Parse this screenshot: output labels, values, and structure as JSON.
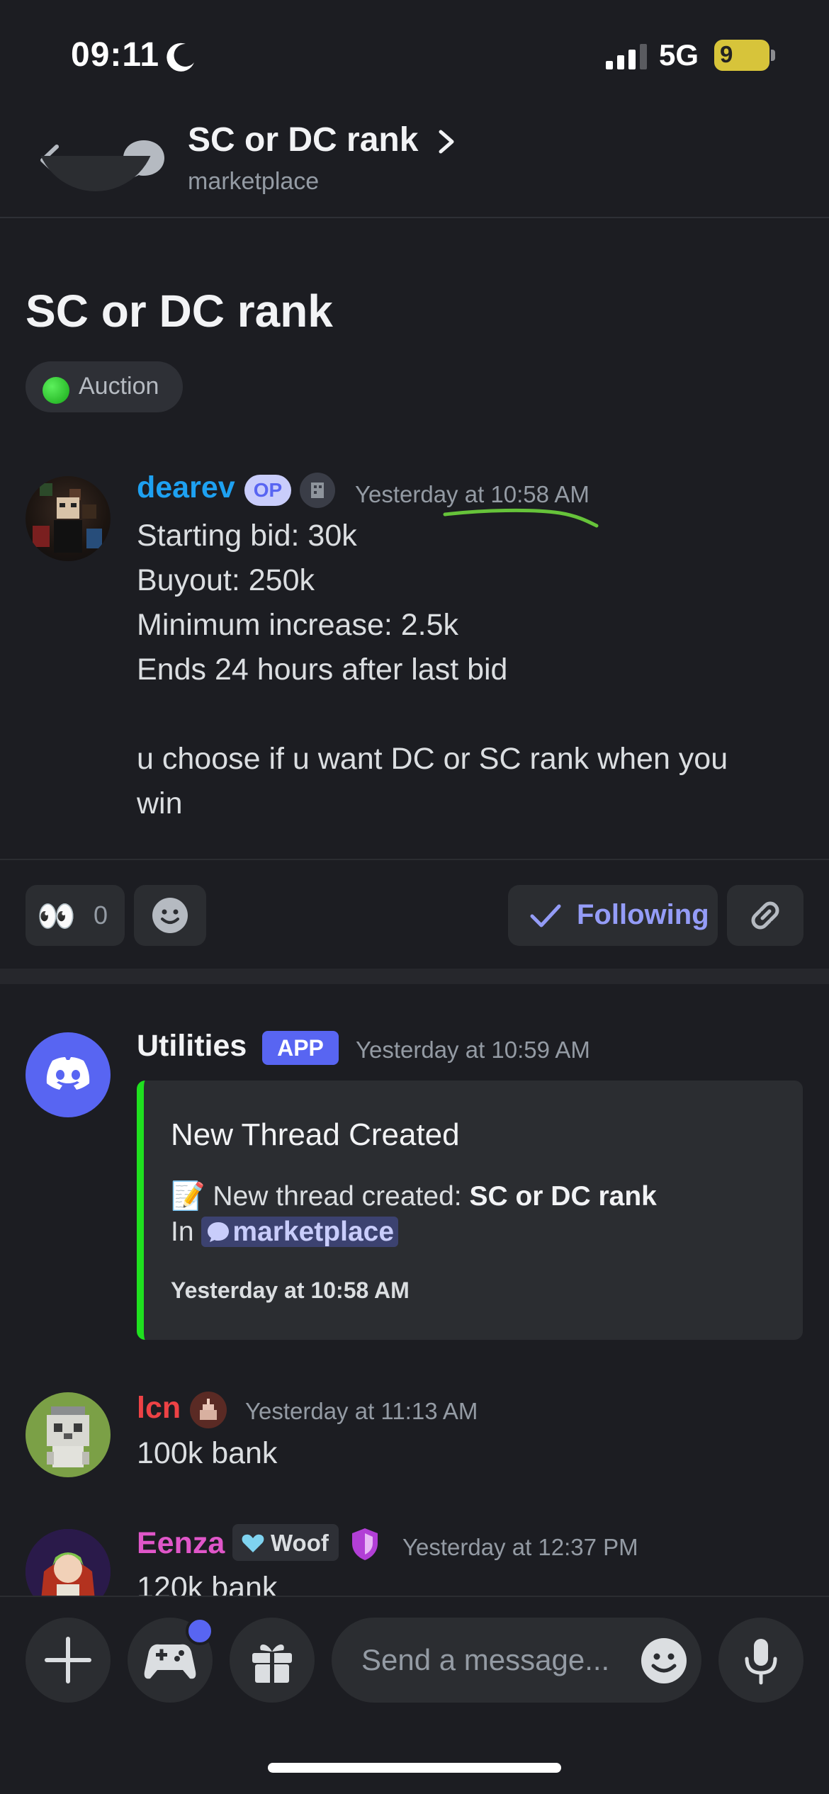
{
  "status_bar": {
    "time": "09:11",
    "network": "5G",
    "battery": "9"
  },
  "header": {
    "title": "SC or DC rank",
    "subtitle": "marketplace"
  },
  "thread": {
    "title": "SC or DC rank",
    "tag": "Auction"
  },
  "messages": [
    {
      "author": "dearev",
      "badge": "OP",
      "time": "Yesterday at 10:58 AM",
      "body": "Starting bid: 30k\nBuyout: 250k\nMinimum increase: 2.5k\nEnds 24 hours after last bid\n\nu choose if u want DC or SC rank when you\nwin"
    },
    {
      "author": "Utilities",
      "badge": "APP",
      "time": "Yesterday at 10:59 AM",
      "embed": {
        "title": "New Thread Created",
        "line1_prefix": "New thread created: ",
        "line1_bold": "SC or DC rank",
        "line2_prefix": "In ",
        "channel": "marketplace",
        "footer": "Yesterday at 10:58 AM"
      }
    },
    {
      "author": "lcn",
      "time": "Yesterday at 11:13 AM",
      "body": "100k bank"
    },
    {
      "author": "Eenza",
      "tag": "Woof",
      "time": "Yesterday at 12:37 PM",
      "body": "120k bank"
    }
  ],
  "reactions": {
    "eyes_emoji": "👀",
    "eyes_count": "0",
    "following_label": "Following"
  },
  "composer": {
    "placeholder": "Send a message..."
  },
  "colors": {
    "background": "#1c1d22",
    "blurple": "#5865f2",
    "dearev_name": "#1ea1f1",
    "lcn_name": "#ed4245",
    "eenza_name": "#e056c9",
    "embed_accent": "#1fe01f"
  }
}
